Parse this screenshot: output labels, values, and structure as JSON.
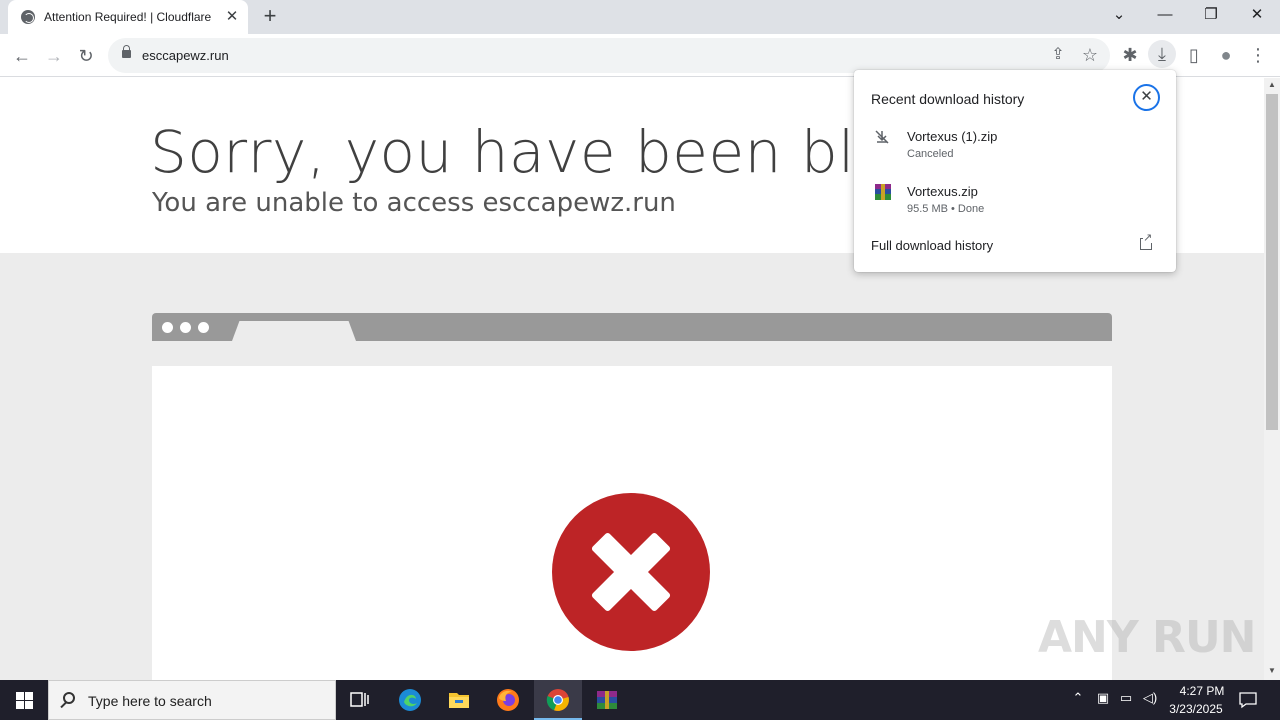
{
  "browser": {
    "tab": {
      "title": "Attention Required! | Cloudflare",
      "close_glyph": "✕",
      "favicon": "globe-icon"
    },
    "new_tab_glyph": "+",
    "window_controls": {
      "tab_search": "⌄",
      "minimize": "—",
      "restore": "❐",
      "close": "✕"
    },
    "toolbar": {
      "back": "←",
      "forward": "→",
      "reload": "↻",
      "url": "esccapewz.run",
      "share": "⇪",
      "bookmark": "☆",
      "extensions": "✱",
      "download": "⤓",
      "side_panel": "▯",
      "profile": "●",
      "menu": "⋮"
    }
  },
  "page": {
    "headline": "Sorry, you have been blocked",
    "subline": "You are unable to access esccapewz.run"
  },
  "downloads": {
    "title": "Recent download history",
    "close_glyph": "✕",
    "items": [
      {
        "name": "Vortexus (1).zip",
        "status": "Canceled",
        "icon": "canceled-download-icon"
      },
      {
        "name": "Vortexus.zip",
        "status": "95.5 MB • Done",
        "icon": "winrar-archive-icon"
      }
    ],
    "full_history": "Full download history"
  },
  "watermark": "ANY RUN",
  "taskbar": {
    "search_placeholder": "Type here to search",
    "time": "4:27 PM",
    "date": "3/23/2025"
  },
  "colors": {
    "accent_blue": "#1a73e8",
    "error_red": "#bd2426",
    "taskbar": "#1f1f2b"
  }
}
